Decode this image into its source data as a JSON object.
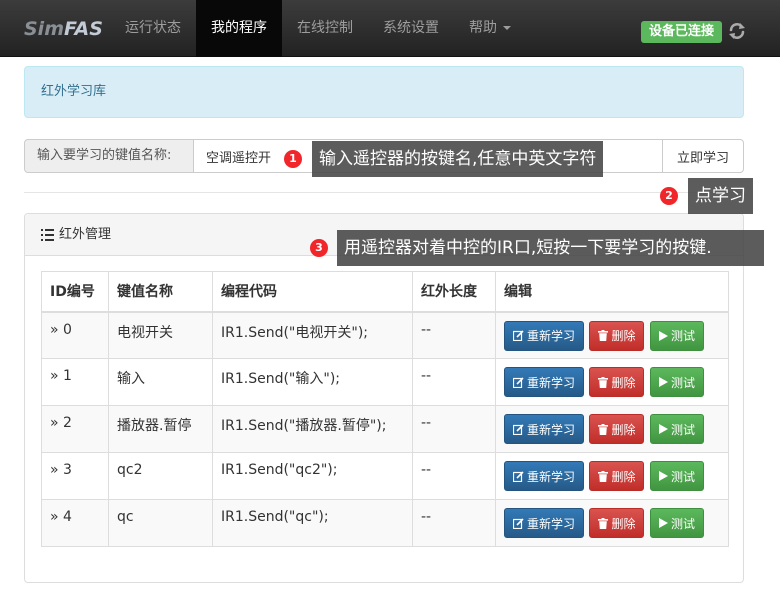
{
  "navbar": {
    "brand_a": "Sim",
    "brand_b": "FAS",
    "items": [
      {
        "label": "运行状态"
      },
      {
        "label": "我的程序"
      },
      {
        "label": "在线控制"
      },
      {
        "label": "系统设置"
      },
      {
        "label": "帮助"
      }
    ],
    "status_badge": "设备已连接"
  },
  "alert": {
    "text": "红外学习库"
  },
  "learn_form": {
    "addon_label": "输入要学习的键值名称:",
    "input_value": "空调遥控开",
    "button_label": "立即学习"
  },
  "panel": {
    "heading": "红外管理",
    "columns": [
      "ID编号",
      "键值名称",
      "编程代码",
      "红外长度",
      "编辑"
    ],
    "rows": [
      {
        "id": "» 0",
        "name": "电视开关",
        "code": "IR1.Send(\"电视开关\");",
        "length": "--"
      },
      {
        "id": "» 1",
        "name": "输入",
        "code": "IR1.Send(\"输入\");",
        "length": "--"
      },
      {
        "id": "» 2",
        "name": "播放器.暂停",
        "code": "IR1.Send(\"播放器.暂停\");",
        "length": "--"
      },
      {
        "id": "» 3",
        "name": "qc2",
        "code": "IR1.Send(\"qc2\");",
        "length": "--"
      },
      {
        "id": "» 4",
        "name": "qc",
        "code": "IR1.Send(\"qc\");",
        "length": "--"
      }
    ],
    "actions": {
      "relearn": "重新学习",
      "delete": "删除",
      "test": "测试"
    }
  },
  "annotations": [
    {
      "number": "1",
      "text": "输入遥控器的按键名,任意中英文字符"
    },
    {
      "number": "2",
      "text": "点学习"
    },
    {
      "number": "3",
      "text": "用遥控器对着中控的IR口,短按一下要学习的按键."
    }
  ],
  "colors": {
    "navbar": "#222222",
    "alert_bg": "#d9edf7",
    "success": "#5cb85c",
    "primary": "#337ab7",
    "danger": "#d9534f",
    "marker": "#f0262a"
  }
}
